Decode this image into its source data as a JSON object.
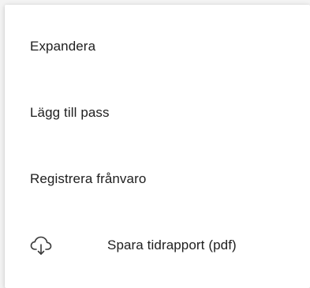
{
  "menu": {
    "items": [
      {
        "label": "Expandera"
      },
      {
        "label": "Lägg till pass"
      },
      {
        "label": "Registrera frånvaro"
      },
      {
        "label": "Spara tidrapport (pdf)",
        "icon": "cloud-download-icon"
      }
    ]
  }
}
